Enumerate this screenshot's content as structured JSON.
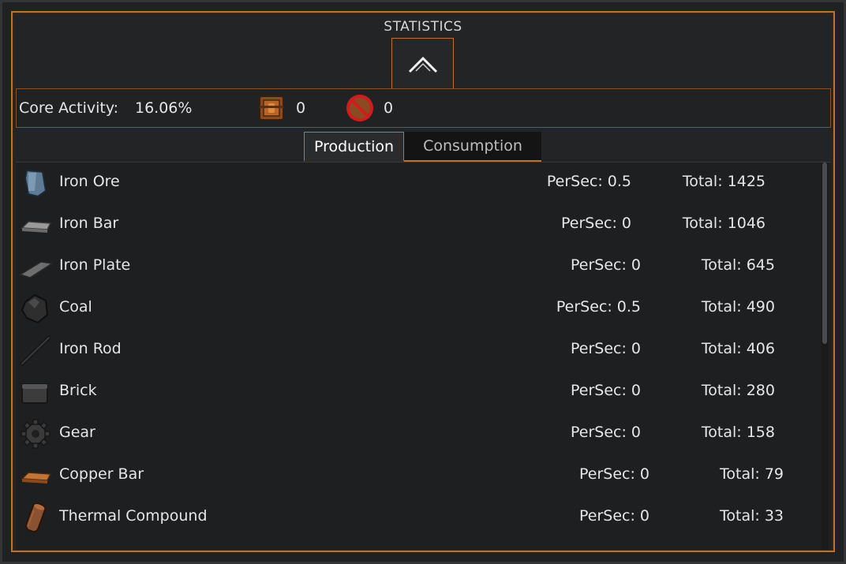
{
  "window": {
    "title": "STATISTICS"
  },
  "core": {
    "label": "Core Activity:",
    "value": "16.06%",
    "counter_a": "0",
    "counter_b": "0"
  },
  "tabs": [
    {
      "label": "Production",
      "active": true
    },
    {
      "label": "Consumption",
      "active": false
    }
  ],
  "items": [
    {
      "name": "Iron Ore",
      "persec": "PerSec: 0.5",
      "total": "Total: 1425",
      "icon": "iron-ore-icon"
    },
    {
      "name": "Iron Bar",
      "persec": "PerSec: 0",
      "total": "Total: 1046",
      "icon": "iron-bar-icon"
    },
    {
      "name": "Iron Plate",
      "persec": "PerSec: 0",
      "total": "Total: 645",
      "icon": "iron-plate-icon"
    },
    {
      "name": "Coal",
      "persec": "PerSec: 0.5",
      "total": "Total: 490",
      "icon": "coal-icon"
    },
    {
      "name": "Iron Rod",
      "persec": "PerSec: 0",
      "total": "Total: 406",
      "icon": "iron-rod-icon"
    },
    {
      "name": "Brick",
      "persec": "PerSec: 0",
      "total": "Total: 280",
      "icon": "brick-icon"
    },
    {
      "name": "Gear",
      "persec": "PerSec: 0",
      "total": "Total: 158",
      "icon": "gear-icon"
    },
    {
      "name": "Copper Bar",
      "persec": "PerSec: 0",
      "total": "Total: 79",
      "icon": "copper-bar-icon"
    },
    {
      "name": "Thermal Compound",
      "persec": "PerSec: 0",
      "total": "Total: 33",
      "icon": "thermal-compound-icon"
    }
  ],
  "colors": {
    "accent": "#c0702a",
    "panel": "#232426",
    "text": "#e6e6e6"
  }
}
